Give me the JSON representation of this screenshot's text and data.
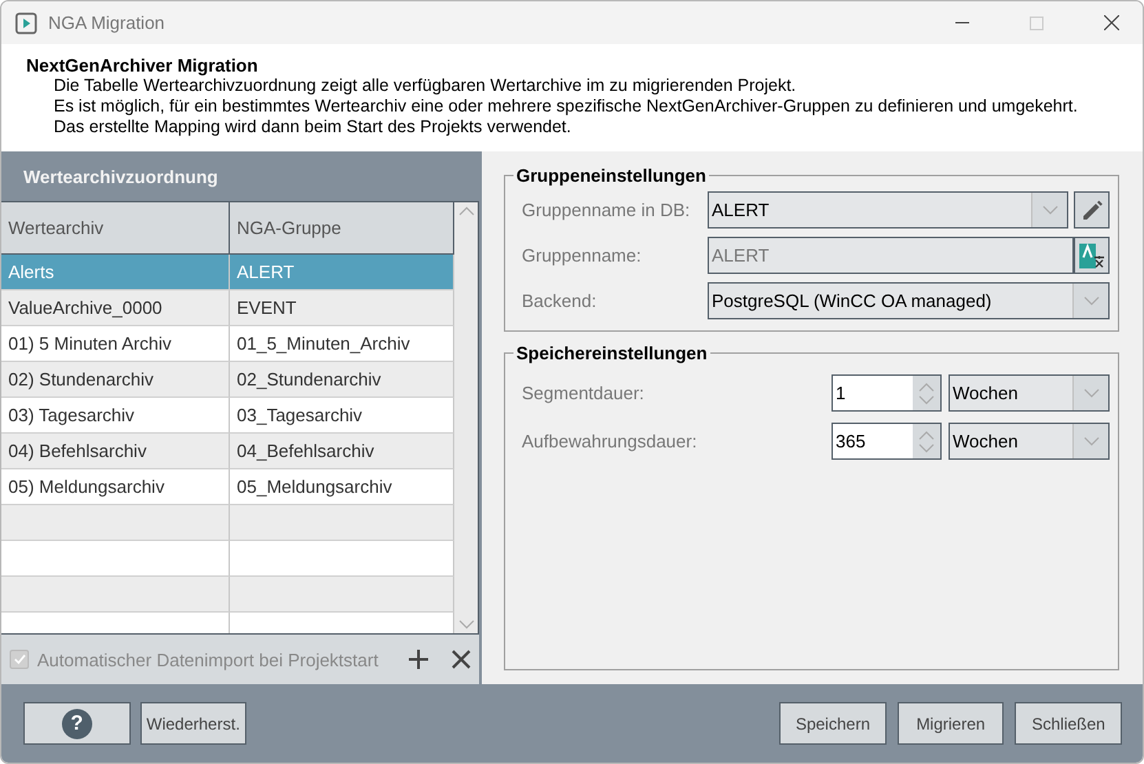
{
  "window": {
    "title": "NGA Migration"
  },
  "header": {
    "title": "NextGenArchiver Migration",
    "lines": [
      "Die Tabelle Wertearchivzuordnung zeigt alle verfügbaren Wertarchive im zu migrierenden Projekt.",
      "Es ist möglich, für ein bestimmtes Wertearchiv eine oder mehrere spezifische NextGenArchiver-Gruppen zu definieren und umgekehrt.",
      "Das erstellte Mapping wird dann beim Start des Projekts verwendet."
    ]
  },
  "mapping": {
    "title": "Wertearchivzuordnung",
    "columns": [
      "Wertearchiv",
      "NGA-Gruppe"
    ],
    "rows": [
      {
        "archive": "Alerts",
        "group": "ALERT",
        "selected": true
      },
      {
        "archive": "ValueArchive_0000",
        "group": "EVENT",
        "selected": false
      },
      {
        "archive": "01) 5 Minuten Archiv",
        "group": "01_5_Minuten_Archiv",
        "selected": false
      },
      {
        "archive": "02) Stundenarchiv",
        "group": "02_Stundenarchiv",
        "selected": false
      },
      {
        "archive": "03) Tagesarchiv",
        "group": "03_Tagesarchiv",
        "selected": false
      },
      {
        "archive": "04) Befehlsarchiv",
        "group": "04_Befehlsarchiv",
        "selected": false
      },
      {
        "archive": "05) Meldungsarchiv",
        "group": "05_Meldungsarchiv",
        "selected": false
      }
    ],
    "auto_import": {
      "label": "Automatischer Datenimport bei Projektstart",
      "checked": true,
      "disabled": true
    }
  },
  "group_settings": {
    "title": "Gruppeneinstellungen",
    "db_name": {
      "label": "Gruppenname in DB:",
      "value": "ALERT"
    },
    "name": {
      "label": "Gruppenname:",
      "value": "ALERT",
      "disabled": true
    },
    "backend": {
      "label": "Backend:",
      "value": "PostgreSQL (WinCC OA managed)"
    }
  },
  "storage_settings": {
    "title": "Speichereinstellungen",
    "fields": [
      {
        "label": "Segmentdauer:",
        "value": "1",
        "unit": "Wochen"
      },
      {
        "label": "Aufbewahrungsdauer:",
        "value": "365",
        "unit": "Wochen"
      }
    ]
  },
  "buttons": {
    "help": "?",
    "restore": "Wiederherst.",
    "save": "Speichern",
    "migrate": "Migrieren",
    "close": "Schließen"
  }
}
